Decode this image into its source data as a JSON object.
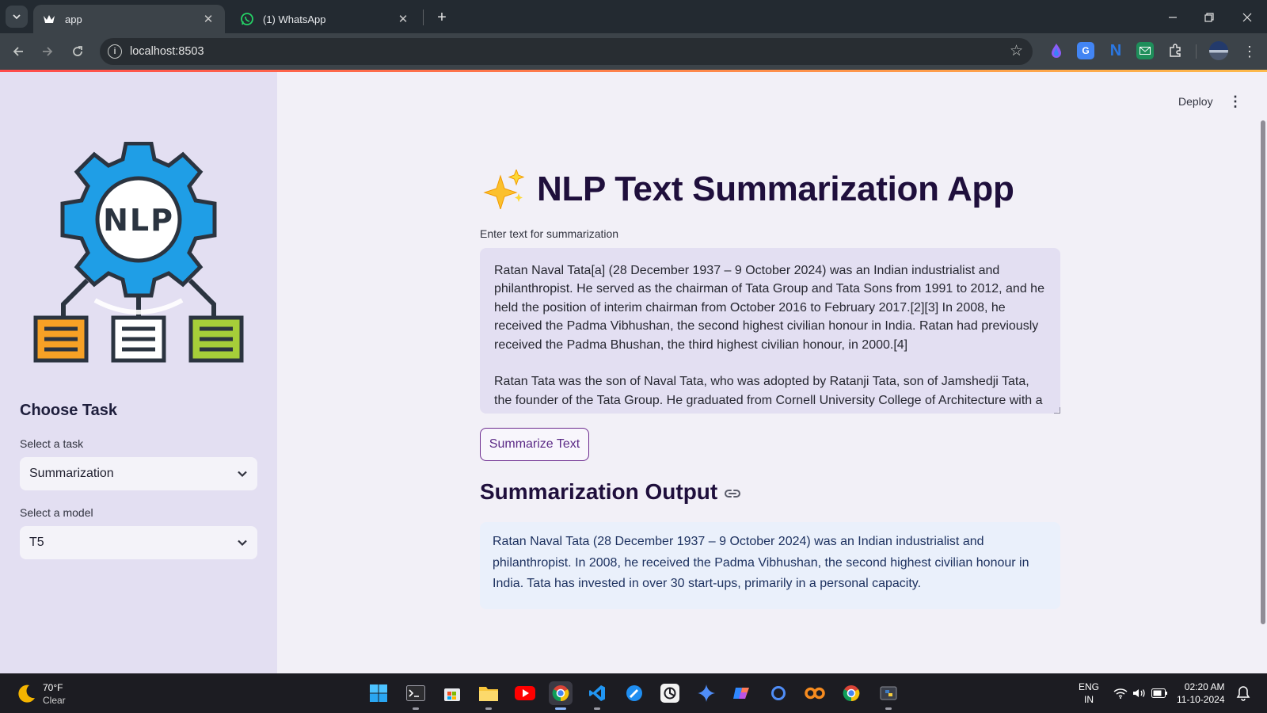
{
  "browser": {
    "tabs": [
      {
        "title": "app",
        "active": true
      },
      {
        "title": "(1) WhatsApp",
        "active": false
      }
    ],
    "url": "localhost:8503"
  },
  "header": {
    "deploy_label": "Deploy"
  },
  "sidebar": {
    "heading": "Choose Task",
    "task_label": "Select a task",
    "task_value": "Summarization",
    "model_label": "Select a model",
    "model_value": "T5",
    "logo_text": "NLP"
  },
  "main": {
    "title": "NLP Text Summarization App",
    "input_label": "Enter text for summarization",
    "input_paragraphs": [
      "Ratan Naval Tata[a] (28 December 1937 – 9 October 2024) was an Indian industrialist and philanthropist. He served as the chairman of Tata Group and Tata Sons from 1991 to 2012, and he held the position of interim chairman from October 2016 to February 2017.[2][3] In 2008, he received the Padma Vibhushan, the second highest civilian honour in India. Ratan had previously received the Padma Bhushan, the third highest civilian honour, in 2000.[4]",
      "Ratan Tata was the son of Naval Tata, who was adopted by Ratanji Tata, son of Jamshedji Tata, the founder of the Tata Group. He graduated from Cornell University College of Architecture with a"
    ],
    "button_label": "Summarize Text",
    "output_heading": "Summarization Output",
    "output_text": "Ratan Naval Tata (28 December 1937 – 9 October 2024) was an Indian industrialist and philanthropist. In 2008, he received the Padma Vibhushan, the second highest civilian honour in India. Tata has invested in over 30 start-ups, primarily in a personal capacity."
  },
  "taskbar": {
    "weather_temp": "70°F",
    "weather_cond": "Clear",
    "lang_line1": "ENG",
    "lang_line2": "IN",
    "time": "02:20 AM",
    "date": "11-10-2024"
  },
  "colors": {
    "accent": "#ff4b4b",
    "sidebar_bg": "#e3dff2",
    "title_color": "#1f0f3c",
    "logo_gear": "#1f9ee6",
    "logo_doc_orange": "#f7a125",
    "logo_doc_green": "#a6ce39"
  }
}
